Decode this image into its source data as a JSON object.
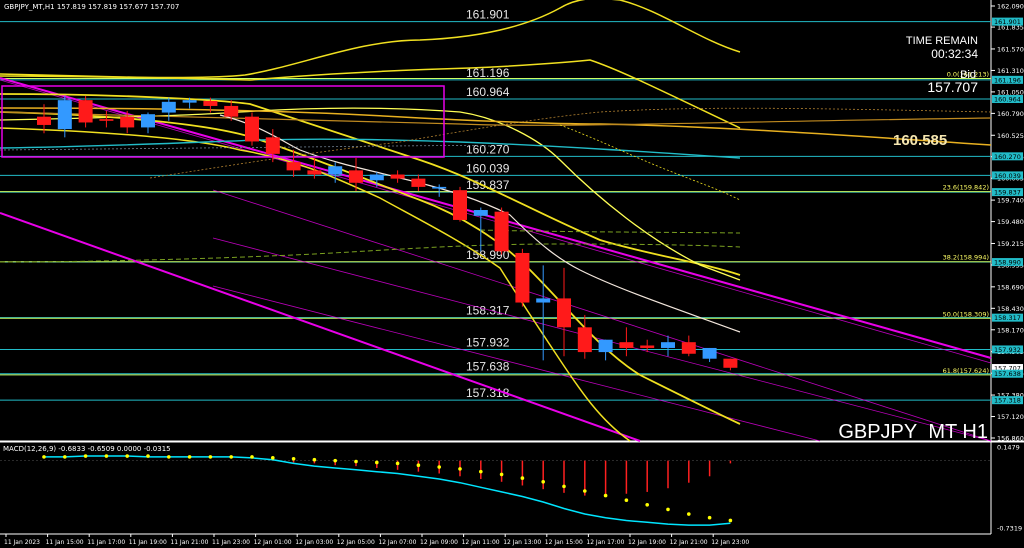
{
  "header": {
    "title": "GBPJPY_MT,H1  157.819 157.819 157.677 157.707"
  },
  "time_remain": {
    "label": "TIME REMAIN",
    "value": "00:32:34"
  },
  "bid": {
    "label": "Bid",
    "value": "157.707"
  },
  "ma_label": "160.585",
  "symbol_label": "GBPJPY_MT H1",
  "macd_label": "MACD(12,26,9) -0.6833 -0.6509 0.0000 -0.0315",
  "fib_labels": [
    {
      "text": "0.0(161.213)",
      "value": 161.213
    },
    {
      "text": "23.6(159.842)",
      "value": 159.842
    },
    {
      "text": "38.2(158.994)",
      "value": 158.994
    },
    {
      "text": "50.0(158.309)",
      "value": 158.309
    },
    {
      "text": "61.8(157.624)",
      "value": 157.624
    }
  ],
  "colors": {
    "background": "#000000",
    "bull": "#3399ff",
    "bear": "#ff1a1a",
    "level_line": "#22bcc8",
    "fib_line": "#ccff66",
    "channel": "#e800e8",
    "band": "#f0e020",
    "ma_main": "#e8b020",
    "macd_signal": "#00e5ff",
    "macd_dots": "#ffff00",
    "macd_hist": "#ff2020"
  },
  "chart_data": {
    "type": "candlestick",
    "ylim": [
      156.86,
      162.09
    ],
    "y_ticks": [
      "162.090",
      "161.835",
      "161.570",
      "161.310",
      "161.050",
      "160.790",
      "160.525",
      "160.265",
      "160.005",
      "159.740",
      "159.480",
      "159.215",
      "158.955",
      "158.690",
      "158.430",
      "158.170",
      "157.905",
      "157.645",
      "157.380",
      "157.120",
      "156.860"
    ],
    "price_tags": [
      "161.901",
      "161.196",
      "160.964",
      "160.270",
      "160.039",
      "159.837",
      "158.990",
      "158.317",
      "157.932",
      "157.707",
      "157.638",
      "157.318"
    ],
    "levels": [
      {
        "label": "161.901",
        "value": 161.901
      },
      {
        "label": "161.196",
        "value": 161.196
      },
      {
        "label": "160.964",
        "value": 160.964
      },
      {
        "label": "160.270",
        "value": 160.27
      },
      {
        "label": "160.039",
        "value": 160.039
      },
      {
        "label": "159.837",
        "value": 159.837
      },
      {
        "label": "158.990",
        "value": 158.99
      },
      {
        "label": "158.317",
        "value": 158.317
      },
      {
        "label": "157.932",
        "value": 157.932
      },
      {
        "label": "157.638",
        "value": 157.638
      },
      {
        "label": "157.318",
        "value": 157.318
      }
    ],
    "x_labels": [
      "11 Jan 2023",
      "11 Jan 15:00",
      "11 Jan 17:00",
      "11 Jan 19:00",
      "11 Jan 21:00",
      "11 Jan 23:00",
      "12 Jan 01:00",
      "12 Jan 03:00",
      "12 Jan 05:00",
      "12 Jan 07:00",
      "12 Jan 09:00",
      "12 Jan 11:00",
      "12 Jan 13:00",
      "12 Jan 15:00",
      "12 Jan 17:00",
      "12 Jan 19:00",
      "12 Jan 21:00",
      "12 Jan 23:00"
    ],
    "candles": [
      {
        "o": 160.75,
        "h": 160.9,
        "l": 160.55,
        "c": 160.65
      },
      {
        "o": 160.6,
        "h": 161.0,
        "l": 160.5,
        "c": 160.95
      },
      {
        "o": 160.95,
        "h": 161.0,
        "l": 160.62,
        "c": 160.68
      },
      {
        "o": 160.72,
        "h": 160.82,
        "l": 160.62,
        "c": 160.7
      },
      {
        "o": 160.75,
        "h": 160.82,
        "l": 160.55,
        "c": 160.62
      },
      {
        "o": 160.62,
        "h": 160.8,
        "l": 160.55,
        "c": 160.78
      },
      {
        "o": 160.8,
        "h": 160.98,
        "l": 160.7,
        "c": 160.93
      },
      {
        "o": 160.92,
        "h": 160.98,
        "l": 160.85,
        "c": 160.95
      },
      {
        "o": 160.94,
        "h": 160.98,
        "l": 160.8,
        "c": 160.88
      },
      {
        "o": 160.88,
        "h": 160.95,
        "l": 160.7,
        "c": 160.75
      },
      {
        "o": 160.75,
        "h": 160.8,
        "l": 160.4,
        "c": 160.45
      },
      {
        "o": 160.5,
        "h": 160.6,
        "l": 160.2,
        "c": 160.3
      },
      {
        "o": 160.2,
        "h": 160.35,
        "l": 160.02,
        "c": 160.1
      },
      {
        "o": 160.1,
        "h": 160.25,
        "l": 160.0,
        "c": 160.05
      },
      {
        "o": 160.05,
        "h": 160.2,
        "l": 159.95,
        "c": 160.15
      },
      {
        "o": 160.1,
        "h": 160.25,
        "l": 159.85,
        "c": 159.95
      },
      {
        "o": 159.98,
        "h": 160.08,
        "l": 159.9,
        "c": 160.05
      },
      {
        "o": 160.05,
        "h": 160.1,
        "l": 159.95,
        "c": 160.0
      },
      {
        "o": 160.0,
        "h": 160.05,
        "l": 159.85,
        "c": 159.9
      },
      {
        "o": 159.88,
        "h": 159.93,
        "l": 159.78,
        "c": 159.9
      },
      {
        "o": 159.86,
        "h": 159.9,
        "l": 159.48,
        "c": 159.5
      },
      {
        "o": 159.55,
        "h": 159.65,
        "l": 159.12,
        "c": 159.62
      },
      {
        "o": 159.6,
        "h": 159.65,
        "l": 159.08,
        "c": 159.12
      },
      {
        "o": 159.1,
        "h": 159.15,
        "l": 158.45,
        "c": 158.5
      },
      {
        "o": 158.5,
        "h": 158.95,
        "l": 157.8,
        "c": 158.55
      },
      {
        "o": 158.55,
        "h": 158.92,
        "l": 157.85,
        "c": 158.2
      },
      {
        "o": 158.2,
        "h": 158.35,
        "l": 157.82,
        "c": 157.9
      },
      {
        "o": 157.9,
        "h": 158.05,
        "l": 157.8,
        "c": 158.05
      },
      {
        "o": 158.02,
        "h": 158.2,
        "l": 157.85,
        "c": 157.95
      },
      {
        "o": 157.98,
        "h": 158.05,
        "l": 157.9,
        "c": 157.95
      },
      {
        "o": 157.95,
        "h": 158.1,
        "l": 157.85,
        "c": 158.02
      },
      {
        "o": 158.02,
        "h": 158.1,
        "l": 157.85,
        "c": 157.88
      },
      {
        "o": 157.82,
        "h": 157.95,
        "l": 157.78,
        "c": 157.95
      },
      {
        "o": 157.82,
        "h": 157.82,
        "l": 157.68,
        "c": 157.71
      }
    ],
    "macd": {
      "ylim": [
        -0.7319,
        0.1479
      ],
      "y_ticks": [
        "0.1479",
        "-0.7319"
      ],
      "histogram": [
        0.0,
        0.0,
        0.0,
        0.0,
        0.0,
        0.0,
        0.0,
        0.0,
        0.0,
        0.0,
        0.0,
        0.0,
        -0.02,
        -0.03,
        -0.05,
        -0.06,
        -0.08,
        -0.1,
        -0.12,
        -0.14,
        -0.17,
        -0.2,
        -0.23,
        -0.27,
        -0.31,
        -0.35,
        -0.38,
        -0.38,
        -0.36,
        -0.34,
        -0.3,
        -0.24,
        -0.17,
        -0.03
      ],
      "signal": [
        0.04,
        0.04,
        0.05,
        0.05,
        0.05,
        0.04,
        0.04,
        0.04,
        0.04,
        0.04,
        0.03,
        0.01,
        -0.03,
        -0.06,
        -0.08,
        -0.1,
        -0.12,
        -0.14,
        -0.17,
        -0.2,
        -0.24,
        -0.29,
        -0.34,
        -0.39,
        -0.45,
        -0.52,
        -0.58,
        -0.62,
        -0.65,
        -0.67,
        -0.69,
        -0.7,
        -0.7,
        -0.68
      ],
      "macd_dots": [
        0.04,
        0.04,
        0.05,
        0.05,
        0.05,
        0.05,
        0.04,
        0.04,
        0.04,
        0.04,
        0.04,
        0.03,
        0.02,
        0.01,
        0.0,
        -0.01,
        -0.02,
        -0.03,
        -0.05,
        -0.07,
        -0.09,
        -0.12,
        -0.15,
        -0.19,
        -0.23,
        -0.28,
        -0.33,
        -0.38,
        -0.43,
        -0.48,
        -0.53,
        -0.58,
        -0.62,
        -0.65
      ]
    }
  }
}
